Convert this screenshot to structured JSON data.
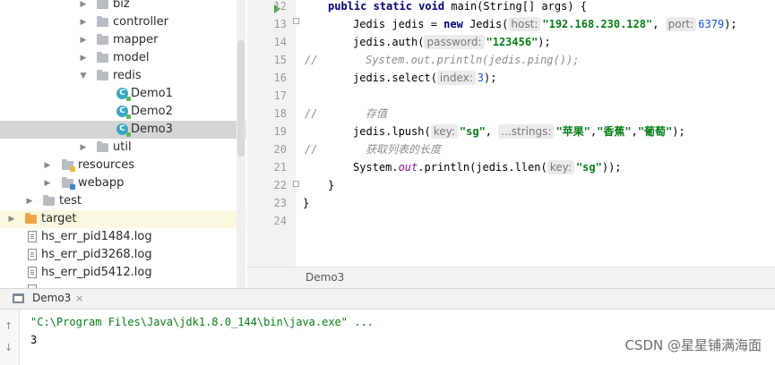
{
  "project_tree": {
    "items": [
      {
        "label": "biz",
        "type": "folder"
      },
      {
        "label": "controller",
        "type": "folder"
      },
      {
        "label": "mapper",
        "type": "folder"
      },
      {
        "label": "model",
        "type": "folder"
      },
      {
        "label": "redis",
        "type": "folder"
      },
      {
        "label": "Demo1",
        "type": "class"
      },
      {
        "label": "Demo2",
        "type": "class"
      },
      {
        "label": "Demo3",
        "type": "class"
      },
      {
        "label": "util",
        "type": "folder"
      },
      {
        "label": "resources",
        "type": "resources-folder"
      },
      {
        "label": "webapp",
        "type": "web-folder"
      },
      {
        "label": "test",
        "type": "folder"
      },
      {
        "label": "target",
        "type": "excluded-folder"
      },
      {
        "label": "hs_err_pid1484.log",
        "type": "file"
      },
      {
        "label": "hs_err_pid3268.log",
        "type": "file"
      },
      {
        "label": "hs_err_pid5412.log",
        "type": "file"
      }
    ]
  },
  "editor": {
    "line_numbers": [
      "12",
      "13",
      "14",
      "15",
      "16",
      "17",
      "18",
      "19",
      "20",
      "21",
      "22",
      "23",
      "24"
    ],
    "tab_label": "Demo3",
    "code": {
      "l12_kw1": "public ",
      "l12_kw2": "static ",
      "l12_kw3": "void ",
      "l12_rest": "main(String[] args) {",
      "l13_a": "Jedis jedis = ",
      "l13_new": "new ",
      "l13_b": "Jedis(",
      "l13_hint1": "host:",
      "l13_str1": "\"192.168.230.128\"",
      "l13_c": ", ",
      "l13_hint2": "port:",
      "l13_num": "6379",
      "l13_d": ");",
      "l14_a": "jedis.auth(",
      "l14_hint": "password:",
      "l14_str": "\"123456\"",
      "l14_b": ");",
      "l15_slash": "//",
      "l15_comment": "System.out.println(jedis.ping());",
      "l16_a": "jedis.select(",
      "l16_hint": "index:",
      "l16_num": "3",
      "l16_b": ");",
      "l18_slash": "//",
      "l18_comment": "存值",
      "l19_a": "jedis.lpush(",
      "l19_hint1": "key:",
      "l19_str1": "\"sg\"",
      "l19_b": ", ",
      "l19_hint2": "...strings:",
      "l19_str2": "\"苹果\"",
      "l19_c": ",",
      "l19_str3": "\"香蕉\"",
      "l19_d": ",",
      "l19_str4": "\"葡萄\"",
      "l19_e": ");",
      "l20_slash": "//",
      "l20_comment": "获取列表的长度",
      "l21_a": "System.",
      "l21_out": "out",
      "l21_b": ".println(jedis.llen(",
      "l21_hint": "key:",
      "l21_str": "\"sg\"",
      "l21_c": "));",
      "l22": "}",
      "l23": "}"
    }
  },
  "run_panel": {
    "tab_label": "Demo3",
    "close_glyph": "×",
    "command": "\"C:\\Program Files\\Java\\jdk1.8.0_144\\bin\\java.exe\" ...",
    "output": "3"
  },
  "watermark": "CSDN @星星铺满海面",
  "colors": {
    "keyword": "#000080",
    "string": "#067d17",
    "comment": "#8c8c8c",
    "selection": "#d5d5d5"
  }
}
